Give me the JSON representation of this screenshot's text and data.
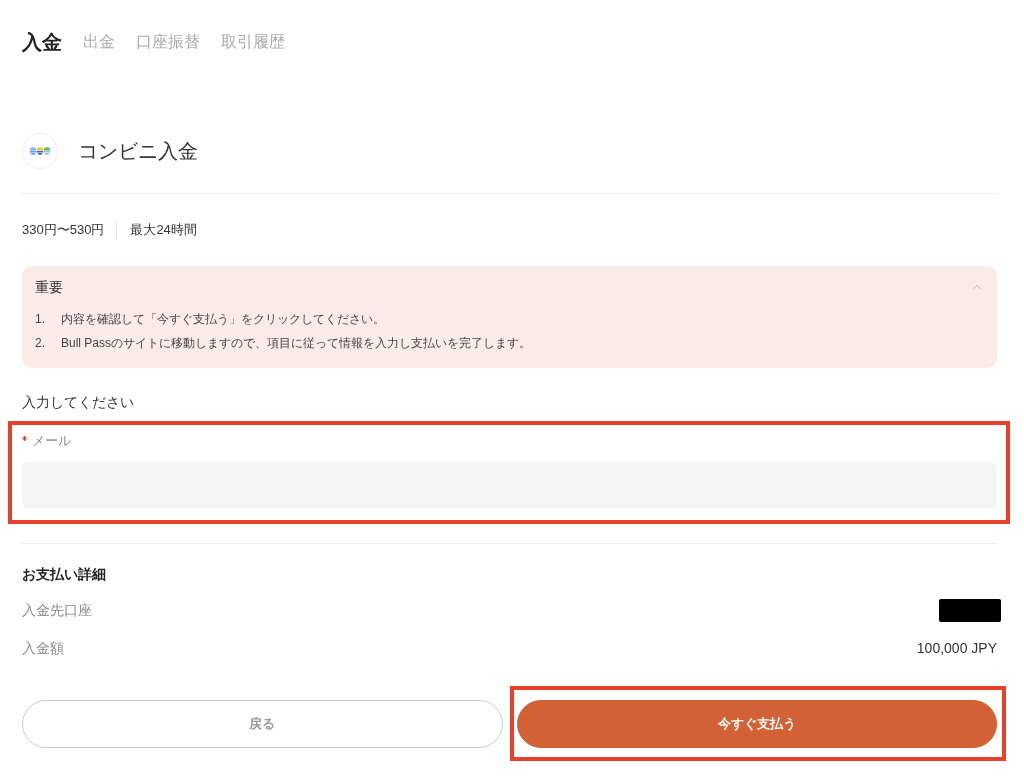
{
  "tabs": [
    {
      "label": "入金",
      "selected": true
    },
    {
      "label": "出金",
      "selected": false
    },
    {
      "label": "口座振替",
      "selected": false
    },
    {
      "label": "取引履歴",
      "selected": false
    }
  ],
  "method": {
    "title": "コンビニ入金",
    "fee": "330円〜530円",
    "time": "最大24時間"
  },
  "notice": {
    "title": "重要",
    "expanded": true,
    "items": [
      {
        "number": "1.",
        "text": "内容を確認して「今すぐ支払う」をクリックしてください。"
      },
      {
        "number": "2.",
        "text": "Bull Passのサイトに移動しますので、項目に従って情報を入力し支払いを完了します。"
      }
    ]
  },
  "form": {
    "heading": "入力してください",
    "fields": [
      {
        "label": "メール",
        "required": true,
        "highlighted": true
      }
    ]
  },
  "details": {
    "title": "お支払い詳細",
    "rows": [
      {
        "label": "入金先口座",
        "redacted": true
      },
      {
        "label": "入金額",
        "value": "100,000 JPY",
        "redacted": false
      }
    ]
  },
  "buttons": [
    {
      "label": "戻る",
      "kind": "secondary",
      "highlighted": false
    },
    {
      "label": "今すぐ支払う",
      "kind": "primary",
      "highlighted": true
    }
  ]
}
